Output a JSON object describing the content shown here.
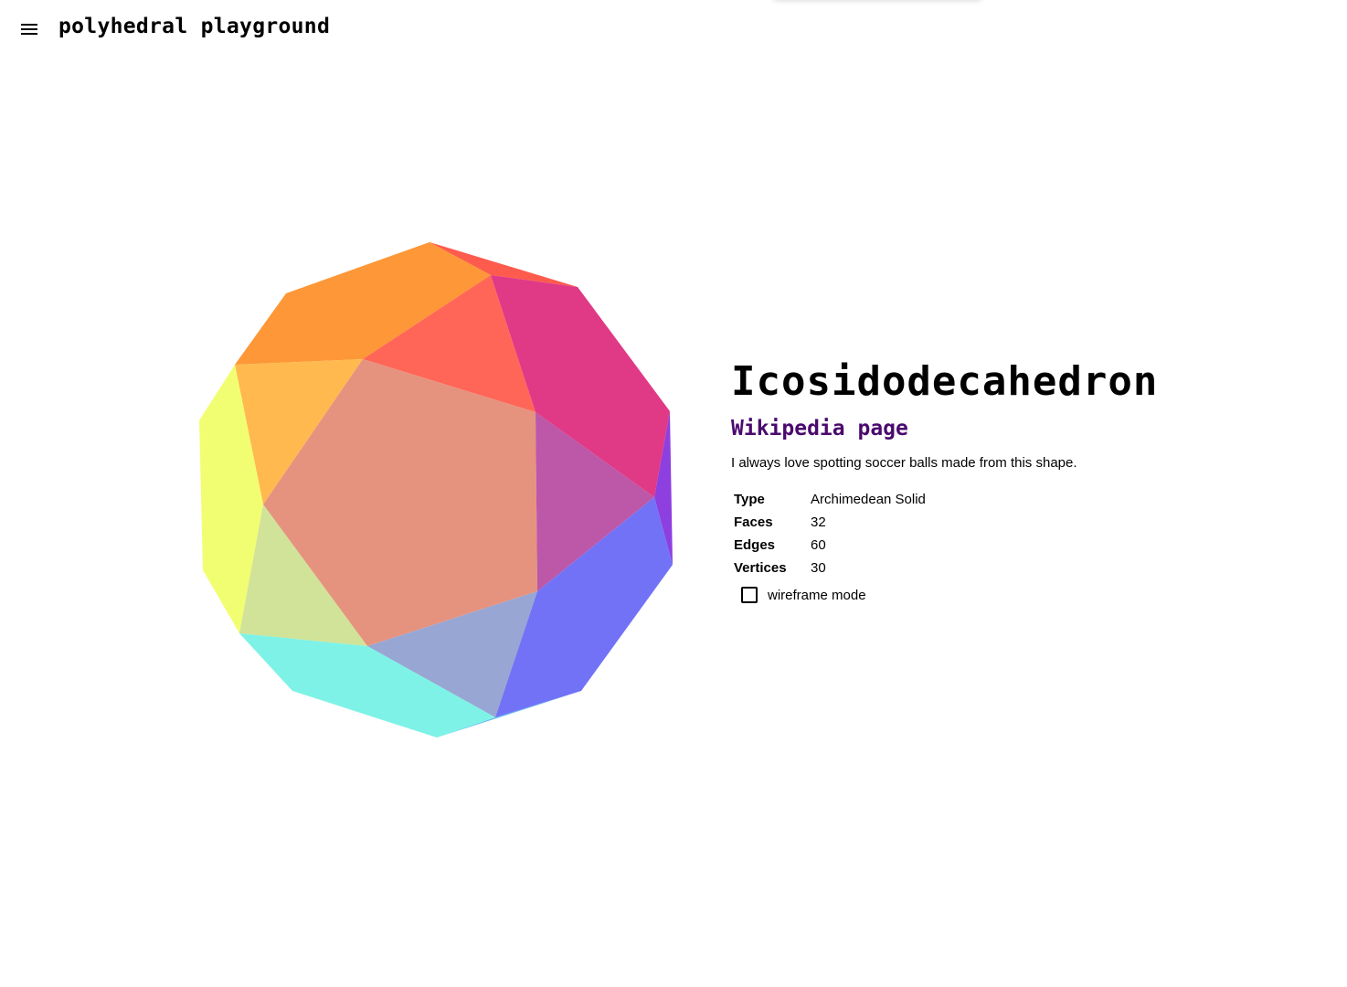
{
  "app": {
    "title": "polyhedral playground",
    "menu_icon": "hamburger-menu-icon"
  },
  "shape": {
    "name": "Icosidodecahedron",
    "wiki_label": "Wikipedia page",
    "description": "I always love spotting soccer balls made from this shape.",
    "properties": [
      {
        "key": "Type",
        "value": "Archimedean Solid"
      },
      {
        "key": "Faces",
        "value": "32"
      },
      {
        "key": "Edges",
        "value": "60"
      },
      {
        "key": "Vertices",
        "value": "30"
      }
    ],
    "wireframe_label": "wireframe mode",
    "wireframe_checked": false
  },
  "colors": {
    "link": "#4b0a6e",
    "faces": [
      "#fe9737",
      "#ff6657",
      "#e03986",
      "#ffb94f",
      "#e5937f",
      "#bd57a8",
      "#f2fe71",
      "#d1e398",
      "#98a6d3",
      "#7272f6",
      "#7ef2e6",
      "#8e3fe0",
      "#fd5b4d"
    ]
  }
}
